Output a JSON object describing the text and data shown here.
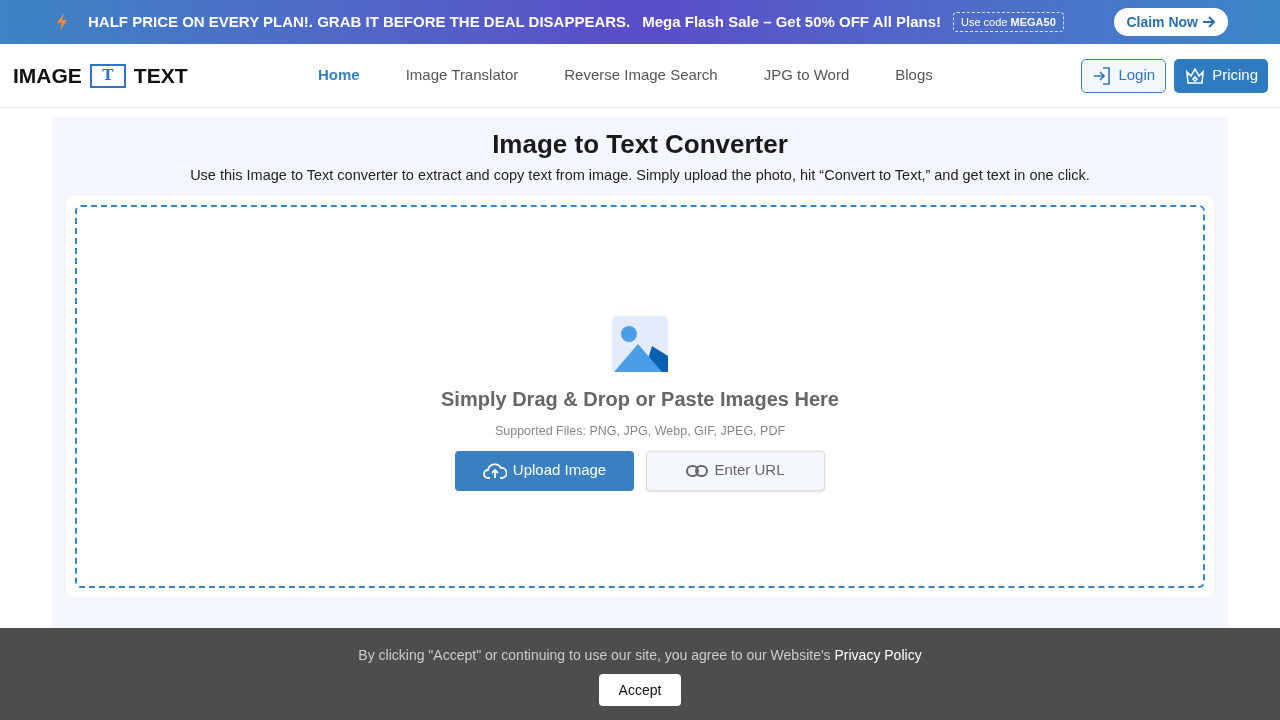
{
  "promo_bar": {
    "headline": "HALF PRICE ON EVERY PLAN!. GRAB IT BEFORE THE DEAL DISAPPEARS.",
    "offer": "Mega Flash Sale – Get 50% OFF All Plans!",
    "code_label": "Use code",
    "code": "MEGA50",
    "cta": "Claim Now"
  },
  "header": {
    "logo_left": "IMAGE",
    "logo_mark": "T",
    "logo_right": "TEXT",
    "nav": [
      {
        "label": "Home",
        "selected": true
      },
      {
        "label": "Image Translator",
        "selected": false
      },
      {
        "label": "Reverse Image Search",
        "selected": false
      },
      {
        "label": "JPG to Word",
        "selected": false
      },
      {
        "label": "Blogs",
        "selected": false
      }
    ],
    "login": "Login",
    "pricing": "Pricing"
  },
  "main": {
    "title": "Image to Text Converter",
    "subtitle": "Use this Image to Text converter to extract and copy text from image. Simply upload the photo, hit “Convert to Text,” and get text in one click.",
    "dropzone": {
      "heading": "Simply Drag & Drop or Paste Images Here",
      "supported": "Supported Files: PNG, JPG, Webp, GIF, JPEG, PDF",
      "upload_button": "Upload Image",
      "url_button": "Enter URL"
    }
  },
  "cookie_banner": {
    "text": "By clicking \"Accept\" or continuing to use our site, you agree to our Website's",
    "link": "Privacy Policy",
    "button": "Accept"
  }
}
